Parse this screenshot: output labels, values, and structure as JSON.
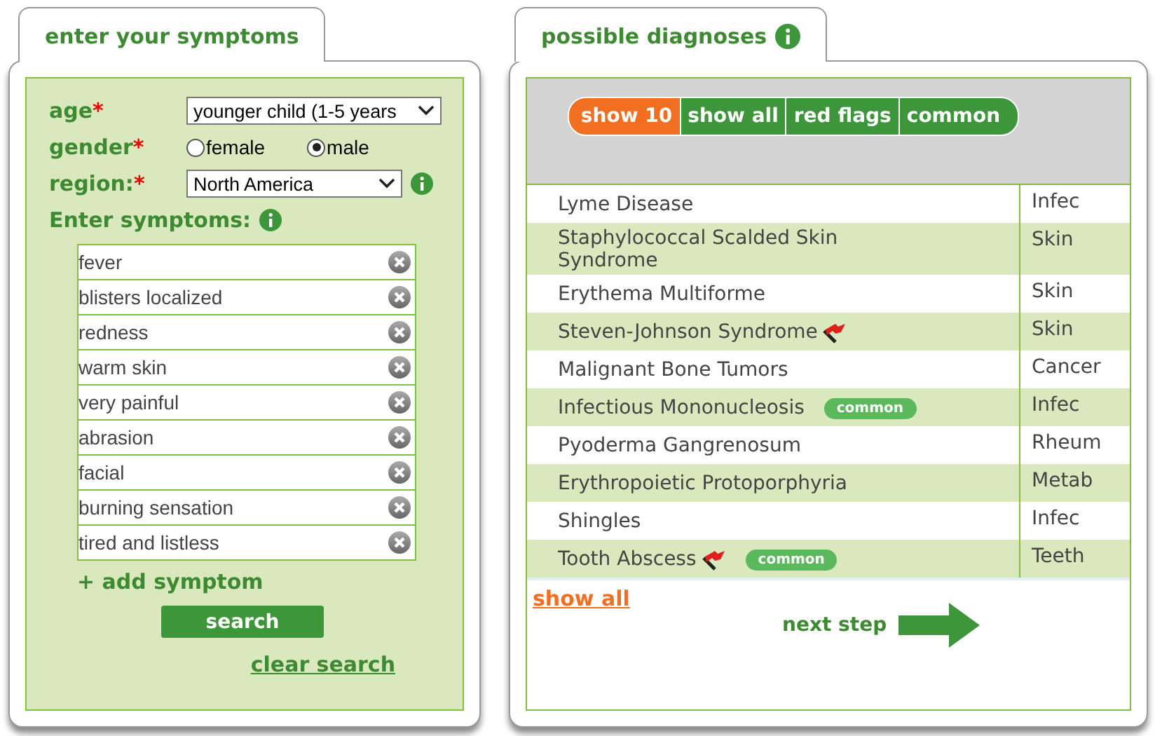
{
  "symptoms_panel": {
    "tab": "enter your symptoms",
    "age": {
      "label": "age",
      "required_mark": "*",
      "value": "younger child (1-5 years"
    },
    "gender": {
      "label": "gender",
      "required_mark": "*",
      "options": [
        {
          "label": "female",
          "selected": false
        },
        {
          "label": "male",
          "selected": true
        }
      ]
    },
    "region": {
      "label": "region:",
      "required_mark": "*",
      "value": "North America"
    },
    "symptoms_label": "Enter symptoms:",
    "symptoms": [
      "fever",
      "blisters localized",
      "redness",
      "warm skin",
      "very painful",
      "abrasion",
      "facial",
      "burning sensation",
      "tired and listless"
    ],
    "add_symptom": "+ add symptom",
    "search_button": "search",
    "clear_search": "clear search"
  },
  "diagnoses_panel": {
    "tab": "possible diagnoses",
    "filters": [
      {
        "label": "show 10",
        "selected": true
      },
      {
        "label": "show all",
        "selected": false
      },
      {
        "label": "red flags",
        "selected": false
      },
      {
        "label": "common",
        "selected": false
      }
    ],
    "rows": [
      {
        "name": "Lyme Disease",
        "category": "Infec",
        "red_flag": false,
        "common_badge": null
      },
      {
        "name": "Staphylococcal Scalded Skin Syndrome",
        "category": "Skin",
        "red_flag": false,
        "common_badge": null
      },
      {
        "name": "Erythema Multiforme",
        "category": "Skin",
        "red_flag": false,
        "common_badge": null
      },
      {
        "name": "Steven-Johnson Syndrome",
        "category": "Skin",
        "red_flag": true,
        "common_badge": null
      },
      {
        "name": "Malignant Bone Tumors",
        "category": "Cancer",
        "red_flag": false,
        "common_badge": null
      },
      {
        "name": "Infectious Mononucleosis",
        "category": "Infec",
        "red_flag": false,
        "common_badge": "common"
      },
      {
        "name": "Pyoderma Gangrenosum",
        "category": "Rheum",
        "red_flag": false,
        "common_badge": null
      },
      {
        "name": "Erythropoietic Protoporphyria",
        "category": "Metab",
        "red_flag": false,
        "common_badge": null
      },
      {
        "name": "Shingles",
        "category": "Infec",
        "red_flag": false,
        "common_badge": null
      },
      {
        "name": "Tooth Abscess",
        "category": "Teeth",
        "red_flag": true,
        "common_badge": "common"
      }
    ],
    "show_all": "show all",
    "next_step": "next step"
  }
}
